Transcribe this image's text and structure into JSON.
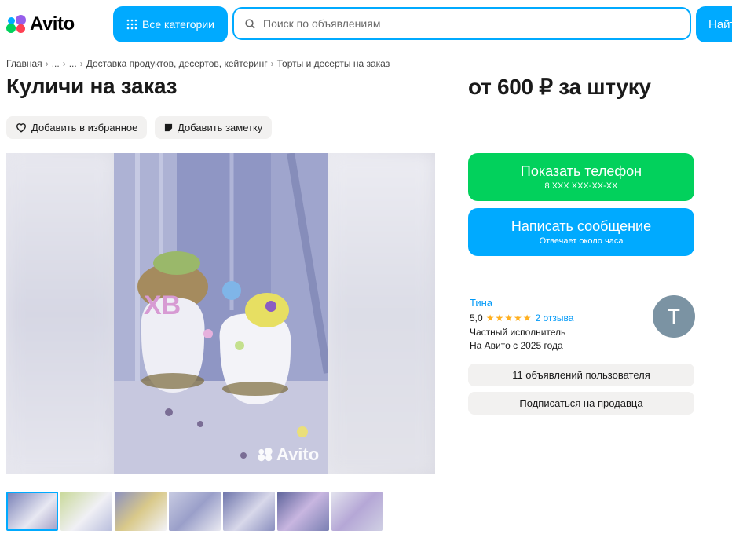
{
  "header": {
    "logo_text": "Avito",
    "categories_label": "Все категории",
    "search_placeholder": "Поиск по объявлениям",
    "find_label": "Найти",
    "brand_color": "#00aaff"
  },
  "breadcrumb": [
    "Главная",
    "...",
    "...",
    "Доставка продуктов, десертов, кейтеринг",
    "Торты и десерты на заказ"
  ],
  "listing": {
    "title": "Куличи на заказ",
    "price": "от 600 ₽ за штуку",
    "favorite_label": "Добавить в избранное",
    "note_label": "Добавить заметку",
    "photo_watermark": "Avito",
    "thumbnails": [
      "thumb-1",
      "thumb-2",
      "thumb-3",
      "thumb-4",
      "thumb-5",
      "thumb-6",
      "thumb-7"
    ]
  },
  "contact": {
    "phone_label": "Показать телефон",
    "phone_mask": "8 XXX XXX-XX-XX",
    "message_label": "Написать сообщение",
    "message_sub": "Отвечает около часа",
    "green_color": "#02d15c"
  },
  "seller": {
    "name": "Тина",
    "rating": "5,0",
    "stars": "★★★★★",
    "reviews": "2 отзыва",
    "type": "Частный исполнитель",
    "since": "На Авито с 2025 года",
    "avatar_letter": "Т",
    "listings_label": "11 объявлений пользователя",
    "subscribe_label": "Подписаться на продавца"
  }
}
